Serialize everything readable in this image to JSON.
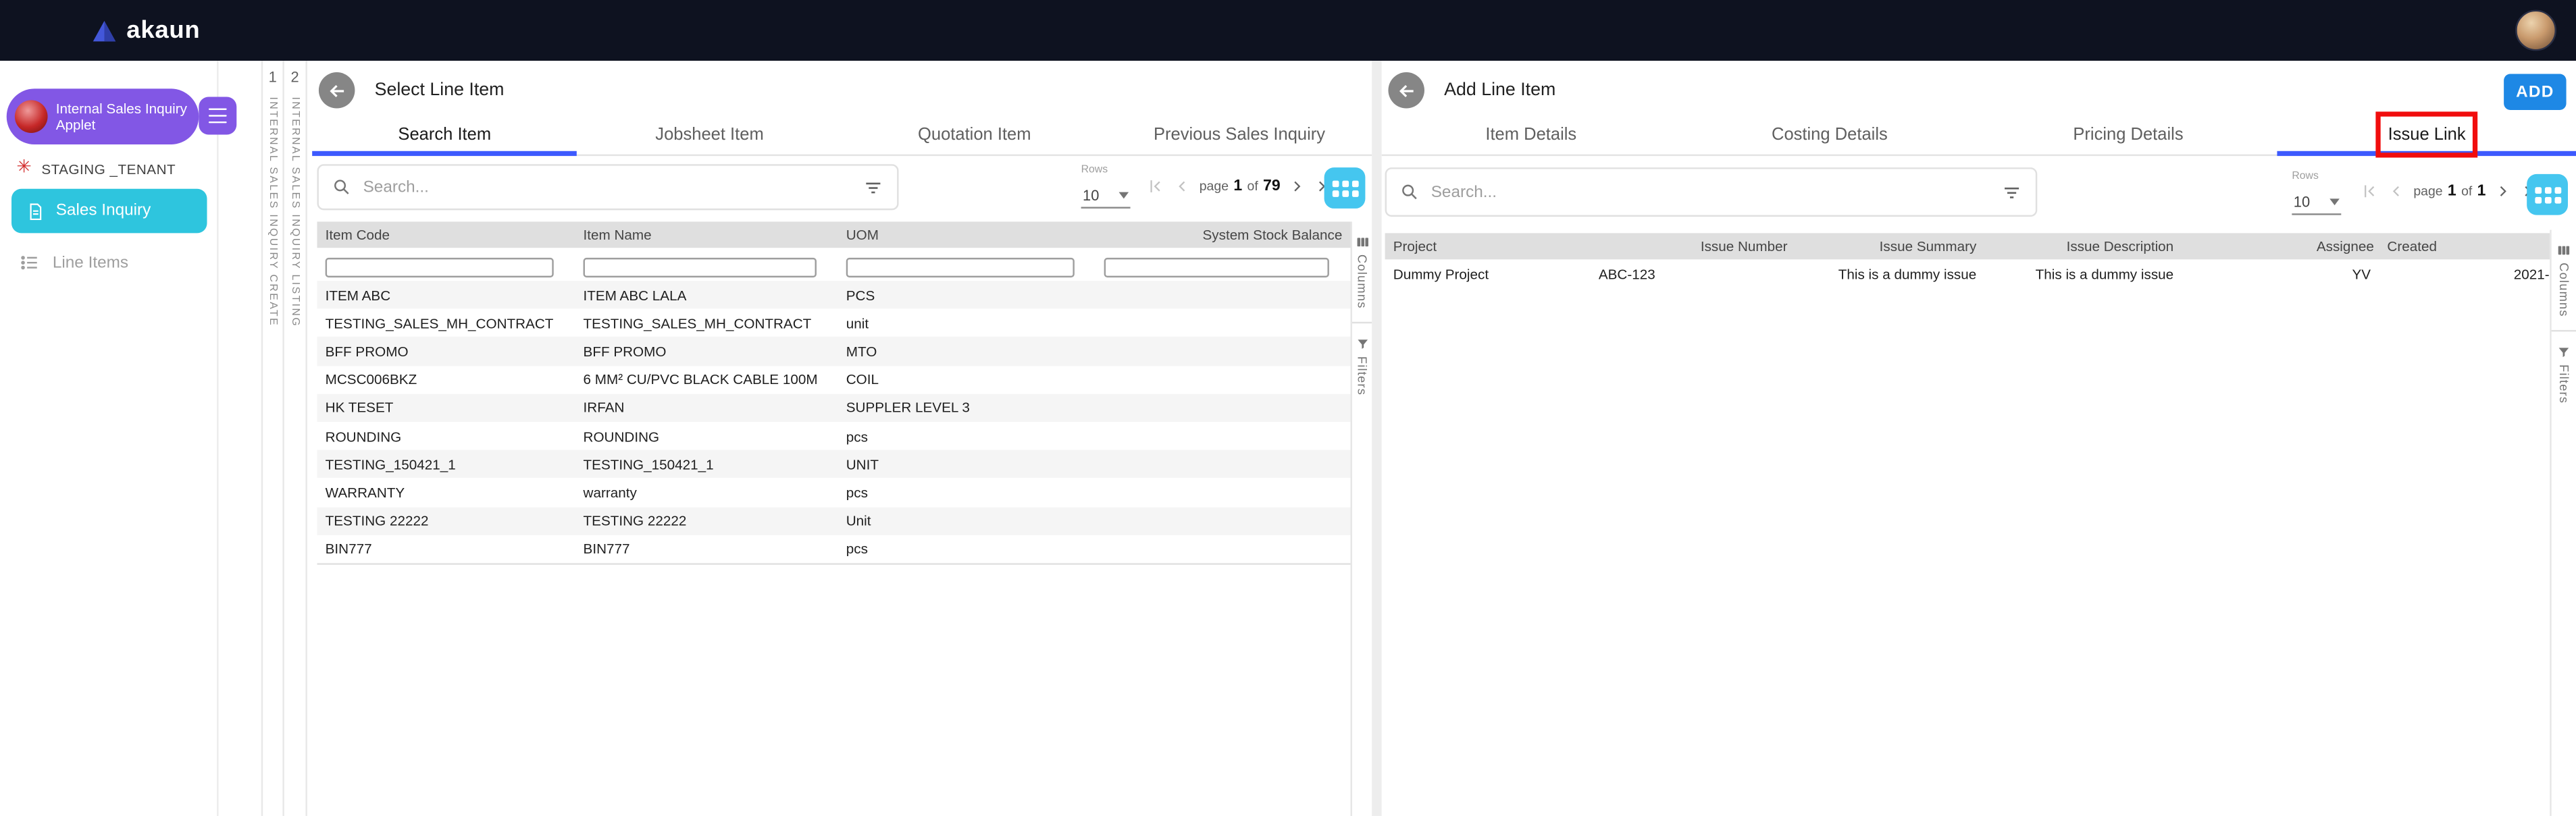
{
  "colors": {
    "topbar_bg": "#0E1220",
    "applet_purple": "#8257E5",
    "sales_inquiry_cyan": "#2EC5DE",
    "add_button_blue": "#1E88E5",
    "view_button_blue": "#45C6EF",
    "active_tab_underline": "#3D5AFE",
    "annotation_red": "#F10D0D"
  },
  "topbar": {
    "logo_text": "akaun"
  },
  "sidebar": {
    "applet_label": "Internal Sales Inquiry Applet",
    "tenant_label": "STAGING _TENANT",
    "items": [
      {
        "label": "Sales Inquiry"
      },
      {
        "label": "Line Items"
      }
    ]
  },
  "workspace_tabs": [
    {
      "number": "1",
      "label": "INTERNAL SALES INQUIRY CREATE"
    },
    {
      "number": "2",
      "label": "INTERNAL SALES INQUIRY LISTING"
    }
  ],
  "left_panel": {
    "title": "Select Line Item",
    "tabs": [
      {
        "label": "Search Item"
      },
      {
        "label": "Jobsheet Item"
      },
      {
        "label": "Quotation Item"
      },
      {
        "label": "Previous Sales Inquiry"
      }
    ],
    "search_placeholder": "Search...",
    "pagination": {
      "rows_label": "Rows",
      "rows_per_page": "10",
      "page_label": "page",
      "page_current": "1",
      "of_label": "of",
      "page_total": "79"
    },
    "table": {
      "columns": [
        "Item Code",
        "Item Name",
        "UOM",
        "System Stock Balance"
      ],
      "rows": [
        [
          "ITEM ABC",
          "ITEM ABC LALA",
          "PCS",
          ""
        ],
        [
          "TESTING_SALES_MH_CONTRACT",
          "TESTING_SALES_MH_CONTRACT",
          "unit",
          ""
        ],
        [
          "BFF PROMO",
          "BFF PROMO",
          "MTO",
          ""
        ],
        [
          "MCSC006BKZ",
          "6 MM² CU/PVC BLACK CABLE 100M",
          "COIL",
          ""
        ],
        [
          "HK TESET",
          "IRFAN",
          "SUPPLER LEVEL 3",
          ""
        ],
        [
          "ROUNDING",
          "ROUNDING",
          "pcs",
          ""
        ],
        [
          "TESTING_150421_1",
          "TESTING_150421_1",
          "UNIT",
          ""
        ],
        [
          "WARRANTY",
          "warranty",
          "pcs",
          ""
        ],
        [
          "TESTING 22222",
          "TESTING 22222",
          "Unit",
          ""
        ],
        [
          "BIN777",
          "BIN777",
          "pcs",
          ""
        ]
      ]
    },
    "rail": {
      "columns_label": "Columns",
      "filters_label": "Filters"
    }
  },
  "right_panel": {
    "title": "Add Line Item",
    "add_button_label": "ADD",
    "tabs": [
      {
        "label": "Item Details"
      },
      {
        "label": "Costing Details"
      },
      {
        "label": "Pricing Details"
      },
      {
        "label": "Issue Link"
      }
    ],
    "search_placeholder": "Search...",
    "pagination": {
      "rows_label": "Rows",
      "rows_per_page": "10",
      "page_label": "page",
      "page_current": "1",
      "of_label": "of",
      "page_total": "1"
    },
    "table": {
      "columns": [
        "Project",
        "Issue Number",
        "Issue Summary",
        "Issue Description",
        "Assignee",
        "Created"
      ],
      "rows": [
        [
          "Dummy Project",
          "ABC-123",
          "This is a dummy issue",
          "This is a dummy issue",
          "YV",
          "2021-"
        ]
      ]
    },
    "rail": {
      "columns_label": "Columns",
      "filters_label": "Filters"
    }
  }
}
